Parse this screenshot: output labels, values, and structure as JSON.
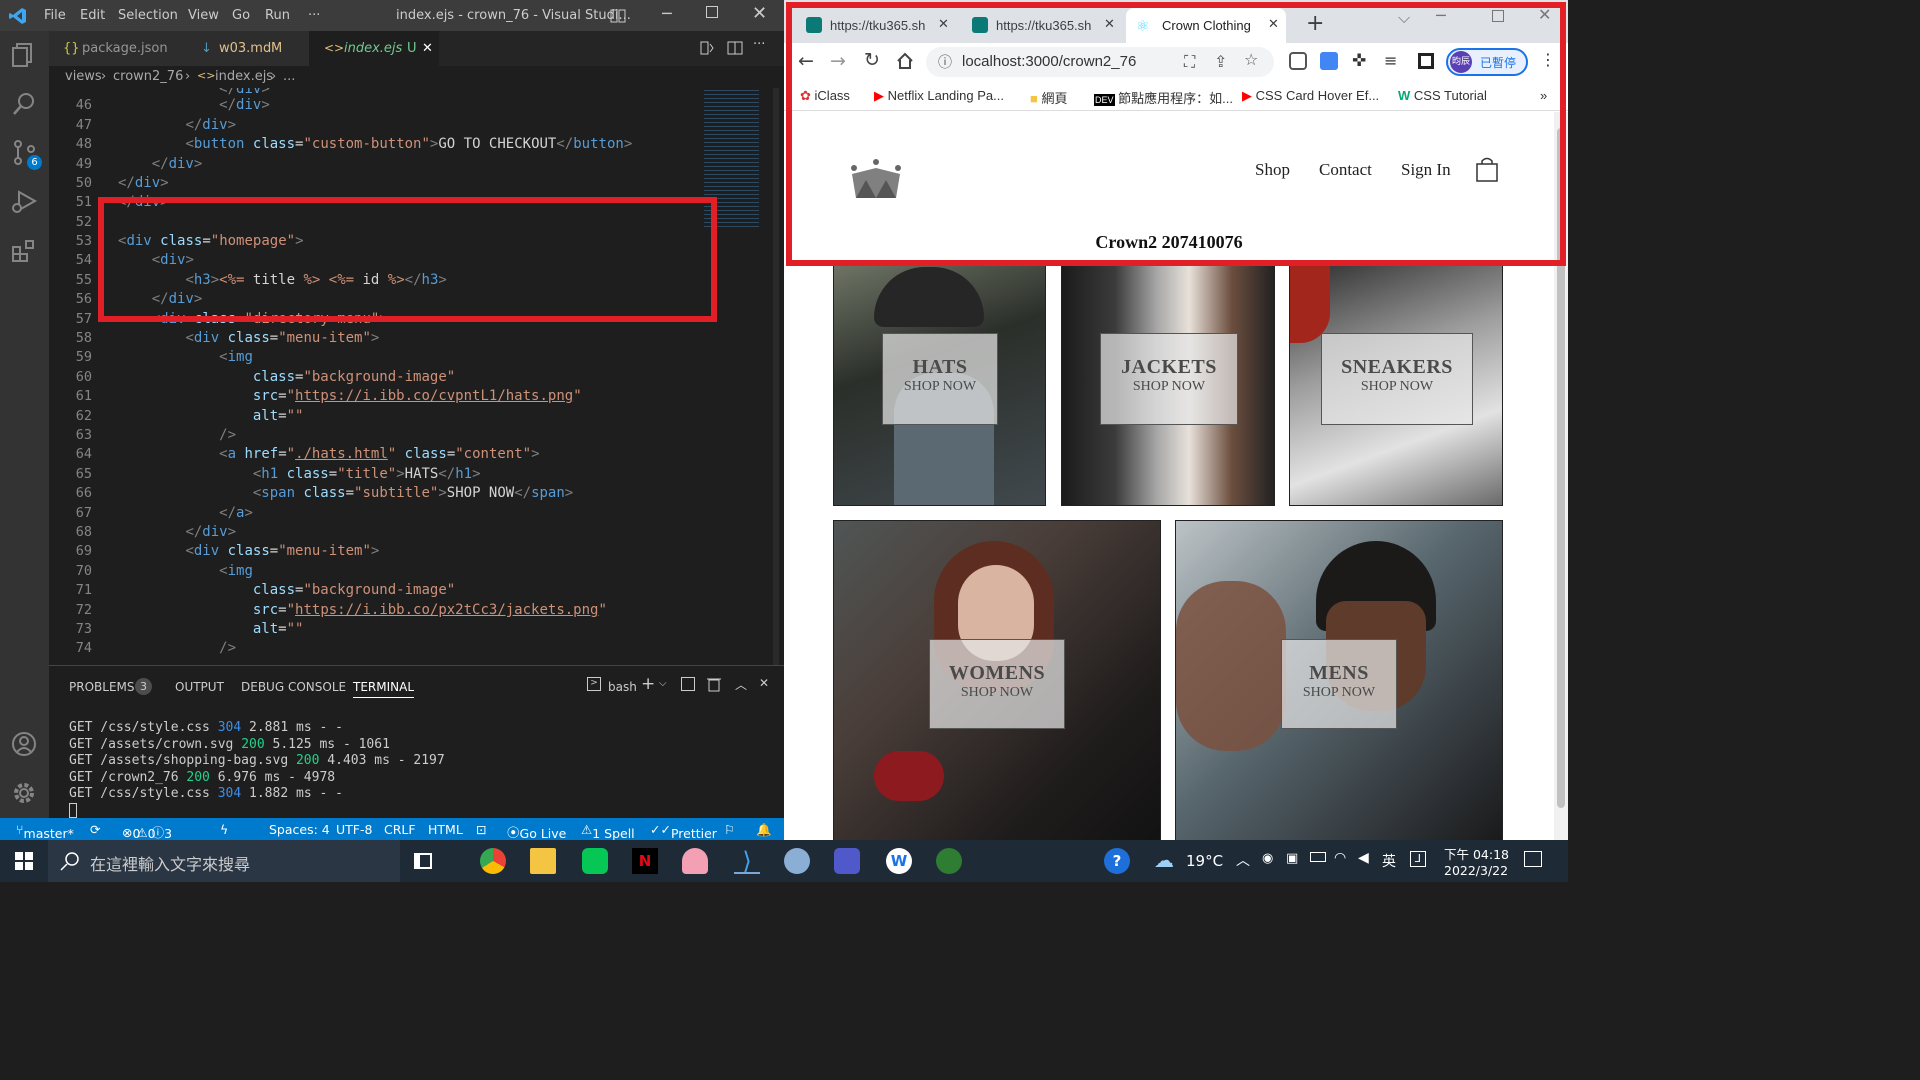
{
  "vscode": {
    "menu": [
      "File",
      "Edit",
      "Selection",
      "View",
      "Go",
      "Run",
      "···"
    ],
    "window_title": "index.ejs - crown_76 - Visual Studi...",
    "scm_badge": "6",
    "tabs": [
      {
        "icon": "{}",
        "label": "package.json"
      },
      {
        "icon": "↓",
        "label": "w03.md",
        "status": "M"
      },
      {
        "icon": "<>",
        "label": "index.ejs",
        "status": "U"
      }
    ],
    "breadcrumb": [
      "views",
      "crown2_76",
      "index.ejs",
      "..."
    ],
    "line_numbers": [
      "46",
      "47",
      "48",
      "49",
      "50",
      "51",
      "52",
      "53",
      "54",
      "55",
      "56",
      "57",
      "58",
      "59",
      "60",
      "61",
      "62",
      "63",
      "64",
      "65",
      "66",
      "67",
      "68",
      "69",
      "70",
      "71",
      "72",
      "73",
      "74"
    ],
    "panel": {
      "tabs": [
        "PROBLEMS",
        "OUTPUT",
        "DEBUG CONSOLE",
        "TERMINAL"
      ],
      "problems_count": "3",
      "shell": "bash",
      "log": [
        {
          "text": "GET /css/style.css ",
          "code": "304",
          "rest": " 2.881 ms - -"
        },
        {
          "text": "GET /assets/crown.svg ",
          "code": "200",
          "rest": " 5.125 ms - 1061"
        },
        {
          "text": "GET /assets/shopping-bag.svg ",
          "code": "200",
          "rest": " 4.403 ms - 2197"
        },
        {
          "text": "GET /crown2_76 ",
          "code": "200",
          "rest": " 6.976 ms - 4978"
        },
        {
          "text": "GET /css/style.css ",
          "code": "304",
          "rest": " 1.882 ms - -"
        }
      ]
    },
    "status": {
      "branch": "master*",
      "errors": "0",
      "warnings": "0",
      "infos": "3",
      "spaces": "Spaces: 4",
      "encoding": "UTF-8",
      "eol": "CRLF",
      "language": "HTML",
      "golive": "Go Live",
      "spell": "1 Spell",
      "prettier": "Prettier"
    }
  },
  "browser": {
    "tabs": [
      {
        "label": "https://tku365.sh"
      },
      {
        "label": "https://tku365.sh"
      },
      {
        "label": "Crown Clothing"
      }
    ],
    "url": "localhost:3000/crown2_76",
    "profile_label": "已暫停",
    "profile_initials": "昀辰",
    "bookmarks": [
      "iClass",
      "Netflix Landing Pa...",
      "網頁",
      "節點應用程序：如...",
      "CSS Card Hover Ef...",
      "CSS Tutorial"
    ],
    "nav": [
      "Shop",
      "Contact",
      "Sign In"
    ],
    "heading": "Crown2 207410076",
    "tiles": [
      {
        "title": "HATS",
        "subtitle": "SHOP NOW"
      },
      {
        "title": "JACKETS",
        "subtitle": "SHOP NOW"
      },
      {
        "title": "SNEAKERS",
        "subtitle": "SHOP NOW"
      },
      {
        "title": "WOMENS",
        "subtitle": "SHOP NOW"
      },
      {
        "title": "MENS",
        "subtitle": "SHOP NOW"
      }
    ]
  },
  "taskbar": {
    "search_placeholder": "在這裡輸入文字來搜尋",
    "temperature": "19°C",
    "ime": "英",
    "time": "下午 04:18",
    "date": "2022/3/22"
  },
  "colors": {
    "highlight": "#e11f26",
    "vscode_blue": "#007acc"
  }
}
